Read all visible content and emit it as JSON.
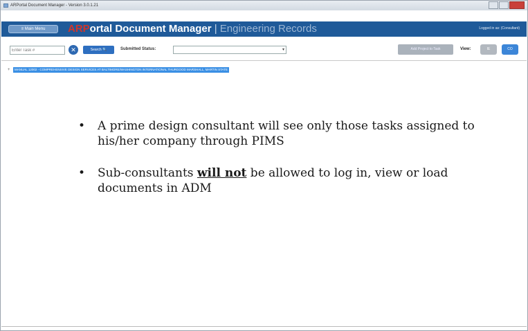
{
  "window": {
    "title": "ARPortal Document Manager - Version 3.0.1.21"
  },
  "header": {
    "main_menu_label": "≡ Main Menu",
    "brand": "ARP",
    "app_name": "ortal Document Manager",
    "separator": " | ",
    "subtitle": "Engineering Records",
    "logged_in": "Logged in as: (Consultant)"
  },
  "toolbar": {
    "task_placeholder": "Enter Task #",
    "clear_label": "✕",
    "search_label": "Search 🔍",
    "status_label": "Submitted Status:",
    "status_value": "",
    "add_project_label": "Add Project to Task",
    "view_label": "View:",
    "view_ie": "IE",
    "view_co": "CO"
  },
  "tree": {
    "expander": "+",
    "project_label": "MANUAL 12002 - COMPREHENSIVE DESIGN SERVICES AT BALTIMORE/WASHINGTON INTERNATIONAL THURGOOD MARSHALL, MARTIN STATE"
  },
  "slide": {
    "bullet1": "A prime design consultant will see only those tasks assigned to his/her company through PIMS",
    "bullet2_before": "Sub-consultants ",
    "bullet2_emphasis": "will not",
    "bullet2_after": " be allowed to log in, view or load documents in ADM"
  },
  "colors": {
    "header_bg": "#1f5a99",
    "brand_red": "#d0352b",
    "accent_blue": "#3a8fe4"
  }
}
